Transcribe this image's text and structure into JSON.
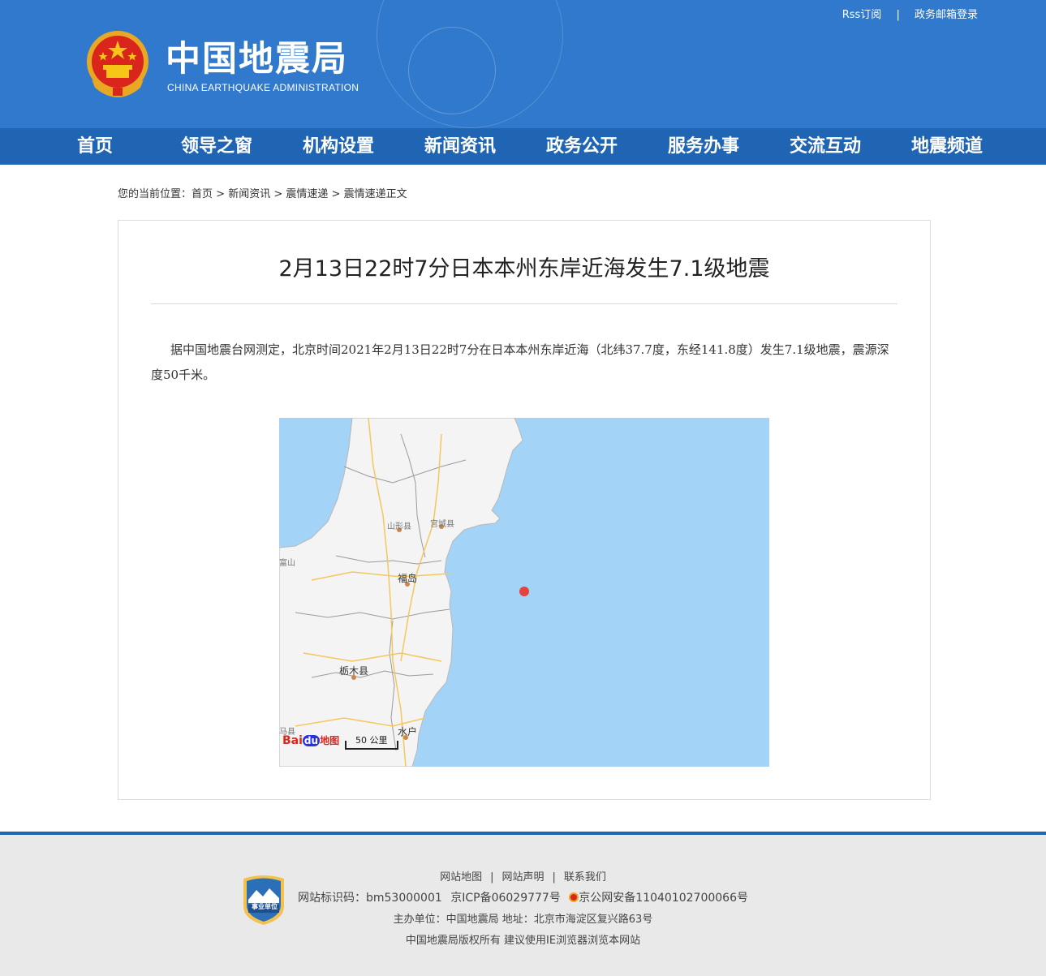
{
  "header": {
    "title": "中国地震局",
    "subtitle": "CHINA EARTHQUAKE ADMINISTRATION",
    "links": [
      "Rss订阅",
      "政务邮箱登录"
    ]
  },
  "nav": [
    "首页",
    "领导之窗",
    "机构设置",
    "新闻资讯",
    "政务公开",
    "服务办事",
    "交流互动",
    "地震频道"
  ],
  "breadcrumb": {
    "prefix": "您的当前位置：",
    "items": [
      "首页",
      "新闻资讯",
      "震情速递",
      "震情速递正文"
    ],
    "separator": " > "
  },
  "article": {
    "title": "2月13日22时7分日本本州东岸近海发生7.1级地震",
    "body": "据中国地震台网测定，北京时间2021年2月13日22时7分在日本本州东岸近海（北纬37.7度，东经141.8度）发生7.1级地震，震源深度50千米。"
  },
  "map": {
    "labels": [
      "山形县",
      "宫城县",
      "福岛",
      "栃木县",
      "水户",
      "马县",
      "富山"
    ],
    "scale": "50 公里",
    "brand": "Bai",
    "brand2": "du",
    "brand3": "地图",
    "sea_color": "#a3d4f7",
    "land_color": "#f4f4f4",
    "marker_color": "#e8413c"
  },
  "footer": {
    "links": [
      "网站地图",
      "网站声明",
      "联系我们"
    ],
    "line2": [
      "网站标识码：bm53000001",
      "京ICP备06029777号",
      "京公网安备11040102700066号"
    ],
    "line3": "主办单位：中国地震局  地址：北京市海淀区复兴路63号",
    "line4": "中国地震局版权所有  建议使用IE浏览器浏览本网站",
    "badge_text": "事业单位"
  }
}
